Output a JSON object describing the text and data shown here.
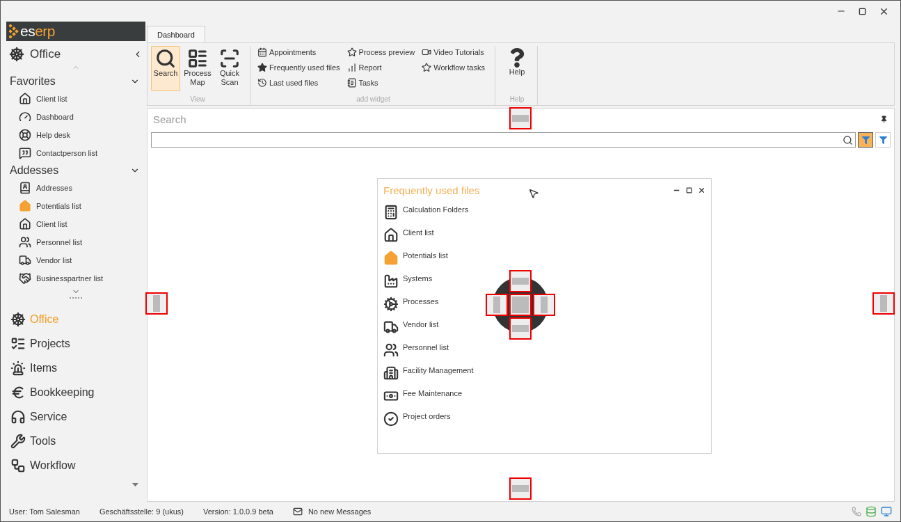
{
  "logo": {
    "text": "es",
    "accent": "erp"
  },
  "sidebar": {
    "module_title": "Office",
    "sections": [
      {
        "title": "Favorites",
        "expanded": true,
        "items": [
          {
            "label": "Client list"
          },
          {
            "label": "Dashboard"
          },
          {
            "label": "Help desk"
          },
          {
            "label": "Contactperson list"
          }
        ]
      },
      {
        "title": "Addesses",
        "expanded": true,
        "items": [
          {
            "label": "Addresses"
          },
          {
            "label": "Potentials list"
          },
          {
            "label": "Client list"
          },
          {
            "label": "Personnel list"
          },
          {
            "label": "Vendor list"
          },
          {
            "label": "Businesspartner list"
          }
        ]
      }
    ],
    "modules": [
      {
        "label": "Office",
        "selected": true
      },
      {
        "label": "Projects",
        "selected": false
      },
      {
        "label": "Items",
        "selected": false
      },
      {
        "label": "Bookkeeping",
        "selected": false
      },
      {
        "label": "Service",
        "selected": false
      },
      {
        "label": "Tools",
        "selected": false
      },
      {
        "label": "Workflow",
        "selected": false
      }
    ]
  },
  "ribbon": {
    "tabs": [
      {
        "label": "Dashboard",
        "selected": true
      }
    ],
    "view_group": {
      "caption": "View",
      "buttons": [
        {
          "label": "Search",
          "selected": true
        },
        {
          "label": "Process Map",
          "selected": false
        },
        {
          "label": "Quick Scan",
          "selected": false
        }
      ]
    },
    "widget_group": {
      "caption": "add widget",
      "columns": [
        [
          "Appointments",
          "Frequently used files",
          "Last used files"
        ],
        [
          "Process preview",
          "Report",
          "Tasks"
        ],
        [
          "Video Tutorials",
          "Workflow tasks"
        ]
      ]
    },
    "help_group": {
      "caption": "Help",
      "button": "Help"
    }
  },
  "search_panel": {
    "title": "Search",
    "filters": [
      {
        "selected": true
      },
      {
        "selected": false
      }
    ]
  },
  "widget": {
    "title": "Frequently used files",
    "items": [
      "Calculation Folders",
      "Client list",
      "Potentials list",
      "Systems",
      "Processes",
      "Vendor list",
      "Personnel list",
      "Facility Management",
      "Fee Maintenance",
      "Project orders"
    ]
  },
  "status_bar": {
    "user": "User: Tom Salesman",
    "branch": "Geschäftsstelle: 9 (ukus)",
    "version": "Version: 1.0.0.9 beta",
    "messages": "No new Messages"
  }
}
